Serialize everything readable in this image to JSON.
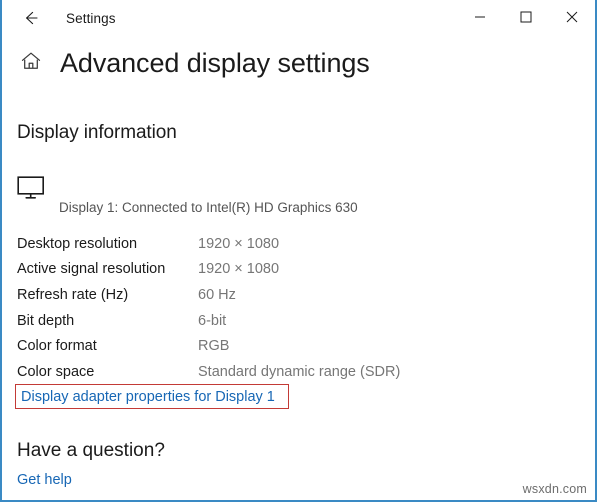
{
  "window": {
    "title": "Settings",
    "accent_color": "#3a8ac4",
    "background": "#ffffff",
    "back_icon": "back-arrow-icon",
    "controls": {
      "minimize": "minimize-icon",
      "maximize": "maximize-icon",
      "close": "close-icon"
    }
  },
  "header": {
    "home_icon": "home-icon",
    "page_title": "Advanced display settings"
  },
  "display_information": {
    "section_heading": "Display information",
    "monitor_icon": "monitor-icon",
    "display_description": "Display 1: Connected to Intel(R) HD Graphics 630",
    "rows": [
      {
        "label": "Desktop resolution",
        "value": "1920 × 1080"
      },
      {
        "label": "Active signal resolution",
        "value": "1920 × 1080"
      },
      {
        "label": "Refresh rate (Hz)",
        "value": "60 Hz"
      },
      {
        "label": "Bit depth",
        "value": "6-bit"
      },
      {
        "label": "Color format",
        "value": "RGB"
      },
      {
        "label": "Color space",
        "value": "Standard dynamic range (SDR)"
      }
    ],
    "adapter_link": "Display adapter properties for Display 1",
    "adapter_link_color": "#1767b5",
    "highlight_box_color": "#c33a36"
  },
  "help": {
    "heading": "Have a question?",
    "link": "Get help",
    "link_color": "#1767b5"
  },
  "watermark": {
    "text": "wsxdn.com"
  }
}
